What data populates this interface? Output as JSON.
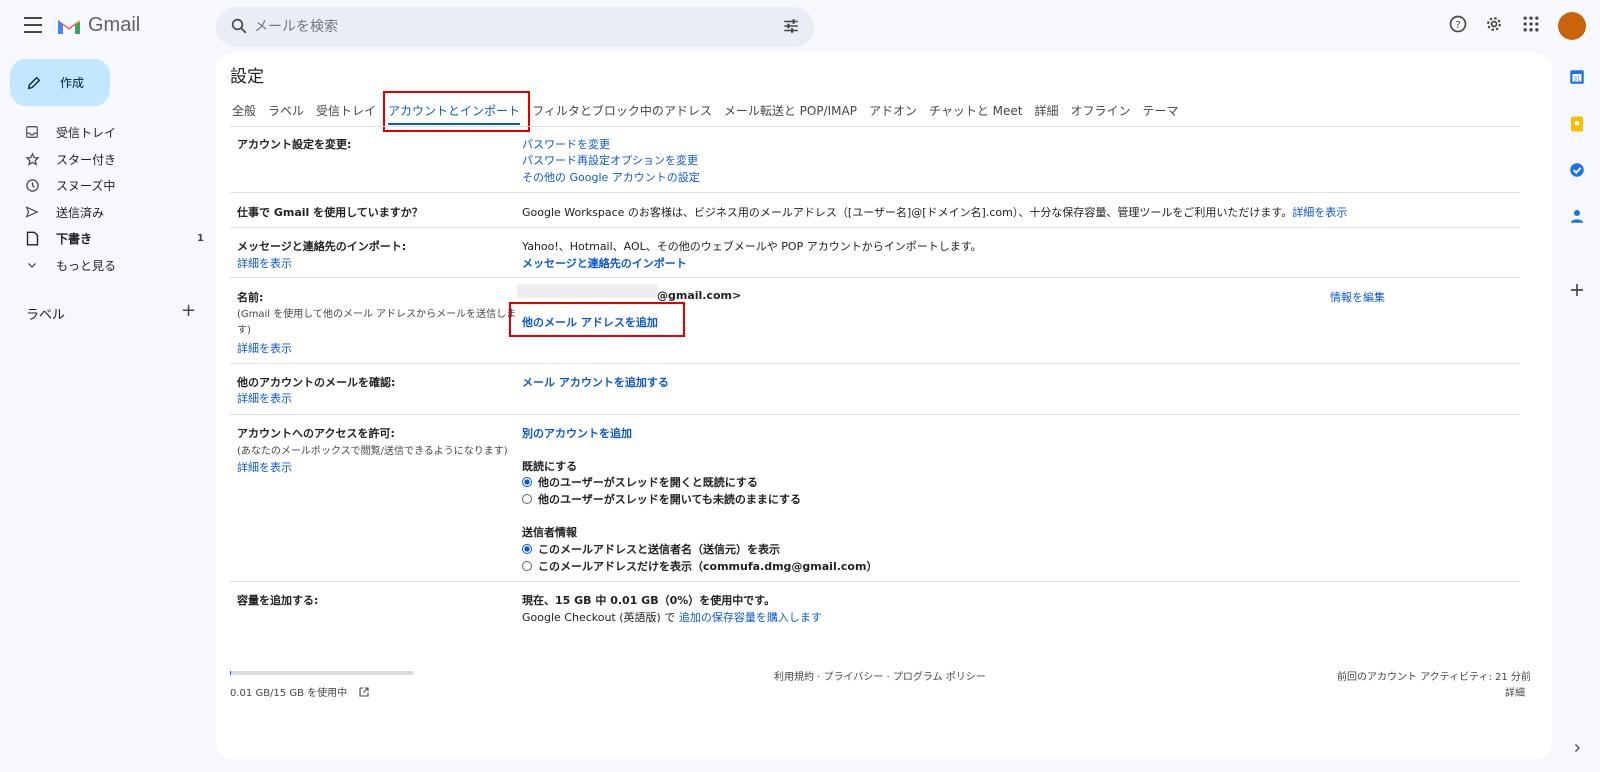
{
  "header": {
    "app_name": "Gmail",
    "search_placeholder": "メールを検索"
  },
  "nav": {
    "compose": "作成",
    "items": [
      {
        "label": "受信トレイ",
        "count": ""
      },
      {
        "label": "スター付き",
        "count": ""
      },
      {
        "label": "スヌーズ中",
        "count": ""
      },
      {
        "label": "送信済み",
        "count": ""
      },
      {
        "label": "下書き",
        "count": "1"
      },
      {
        "label": "もっと見る",
        "count": ""
      }
    ],
    "labels_title": "ラベル",
    "labels_add": "+"
  },
  "settings": {
    "title": "設定",
    "tabs": [
      "全般",
      "ラベル",
      "受信トレイ",
      "アカウントとインポート",
      "フィルタとブロック中のアドレス",
      "メール転送と POP/IMAP",
      "アドオン",
      "チャットと Meet",
      "詳細",
      "オフライン",
      "テーマ"
    ],
    "change_account": {
      "label": "アカウント設定を変更:",
      "links": [
        "パスワードを変更",
        "パスワード再設定オプションを変更",
        "その他の Google アカウントの設定"
      ]
    },
    "work": {
      "label": "仕事で Gmail を使用していますか？",
      "text": "Google Workspace のお客様は、ビジネス用のメールアドレス（[ユーザー名]@[ドメイン名].com）、十分な保存容量、管理ツールをご利用いただけます。",
      "link": "詳細を表示"
    },
    "import": {
      "label": "メッセージと連絡先のインポート:",
      "learn": "詳細を表示",
      "text": "Yahoo!、Hotmail、AOL、その他のウェブメールや POP アカウントからインポートします。",
      "link": "メッセージと連絡先のインポート"
    },
    "name": {
      "label": "名前:",
      "sub1": "(Gmail を使用して他のメール アドレスからメールを送信しま",
      "sub2": "す)",
      "learn": "詳細を表示",
      "email": "@gmail.com>",
      "add_link": "他のメール アドレスを追加",
      "edit": "情報を編集"
    },
    "check_mail": {
      "label": "他のアカウントのメールを確認:",
      "learn": "詳細を表示",
      "link": "メール アカウントを追加する"
    },
    "grant": {
      "label": "アカウントへのアクセスを許可:",
      "sub": "(あなたのメールボックスで閲覧/送信できるようになります)",
      "learn": "詳細を表示",
      "link": "別のアカウントを追加",
      "read_title": "既読にする",
      "read_opt1": "他のユーザーがスレッドを開くと既読にする",
      "read_opt2": "他のユーザーがスレッドを開いても未読のままにする",
      "sender_title": "送信者情報",
      "sender_opt1": "このメールアドレスと送信者名（送信元）を表示",
      "sender_opt2": "このメールアドレスだけを表示（commufa.dmg@gmail.com）"
    },
    "storage": {
      "label": "容量を追加する:",
      "usage": "現在、15 GB 中 0.01 GB（0%）を使用中です。",
      "checkout": "Google Checkout (英語版) で",
      "buy": "追加の保存容量を購入します"
    }
  },
  "footer": {
    "storage_used": "0.01 GB/15 GB を使用中",
    "storage_fraction": 0.001,
    "links": "利用規約 · プライバシー · プログラム ポリシー",
    "activity": "前回のアカウント アクティビティ: 21 分前",
    "details": "詳細"
  },
  "colors": {
    "accent": "#0b57d0",
    "compose_bg": "#c2e7ff",
    "highlight": "#e00000",
    "avatar": "#c9640b"
  }
}
